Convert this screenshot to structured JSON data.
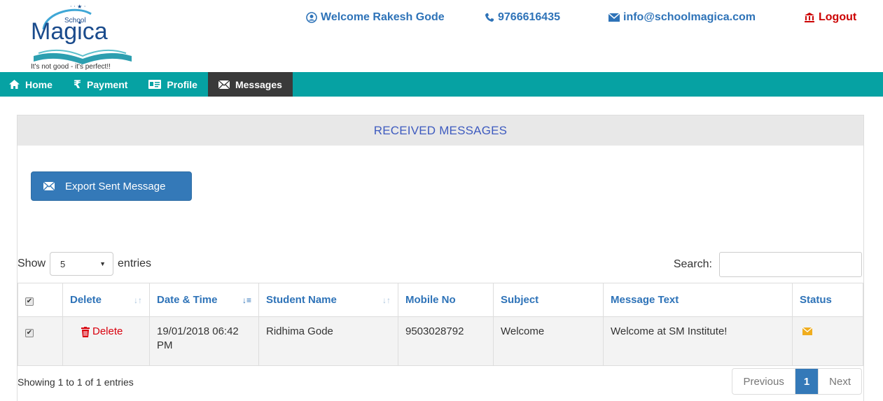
{
  "brand": {
    "name_small": "School",
    "name_big": "Magica",
    "tagline": "It's not good - it's perfect!!"
  },
  "topbar": {
    "welcome": "Welcome Rakesh Gode",
    "phone": "9766616435",
    "email": "info@schoolmagica.com",
    "logout": "Logout"
  },
  "nav": {
    "items": [
      {
        "label": "Home",
        "icon": "home-icon"
      },
      {
        "label": "Payment",
        "icon": "rupee-icon"
      },
      {
        "label": "Profile",
        "icon": "id-card-icon"
      },
      {
        "label": "Messages",
        "icon": "envelope-icon",
        "active": true
      }
    ]
  },
  "panel": {
    "title": "RECEIVED MESSAGES",
    "export_label": "Export Sent Message"
  },
  "controls": {
    "show_label": "Show",
    "entries_value": "5",
    "entries_label": "entries",
    "search_label": "Search:",
    "search_value": ""
  },
  "table": {
    "columns": [
      "",
      "Delete",
      "Date & Time",
      "Student Name",
      "Mobile No",
      "Subject",
      "Message Text",
      "Status"
    ],
    "rows": [
      {
        "checked": true,
        "delete_label": "Delete",
        "date_time": "19/01/2018 06:42 PM",
        "student_name": "Ridhima Gode",
        "mobile": "9503028792",
        "subject": "Welcome",
        "message": "Welcome at SM Institute!",
        "status_icon": "envelope-icon"
      }
    ]
  },
  "footer": {
    "info": "Showing 1 to 1 of 1 entries",
    "previous": "Previous",
    "current_page": "1",
    "next": "Next"
  },
  "colors": {
    "nav_bg": "#06a2a3",
    "nav_active": "#3a3a3a",
    "link_blue": "#2e73b8",
    "button_blue": "#3479b8",
    "danger_red": "#d9000d",
    "status_yellow": "#f0ad1e"
  }
}
